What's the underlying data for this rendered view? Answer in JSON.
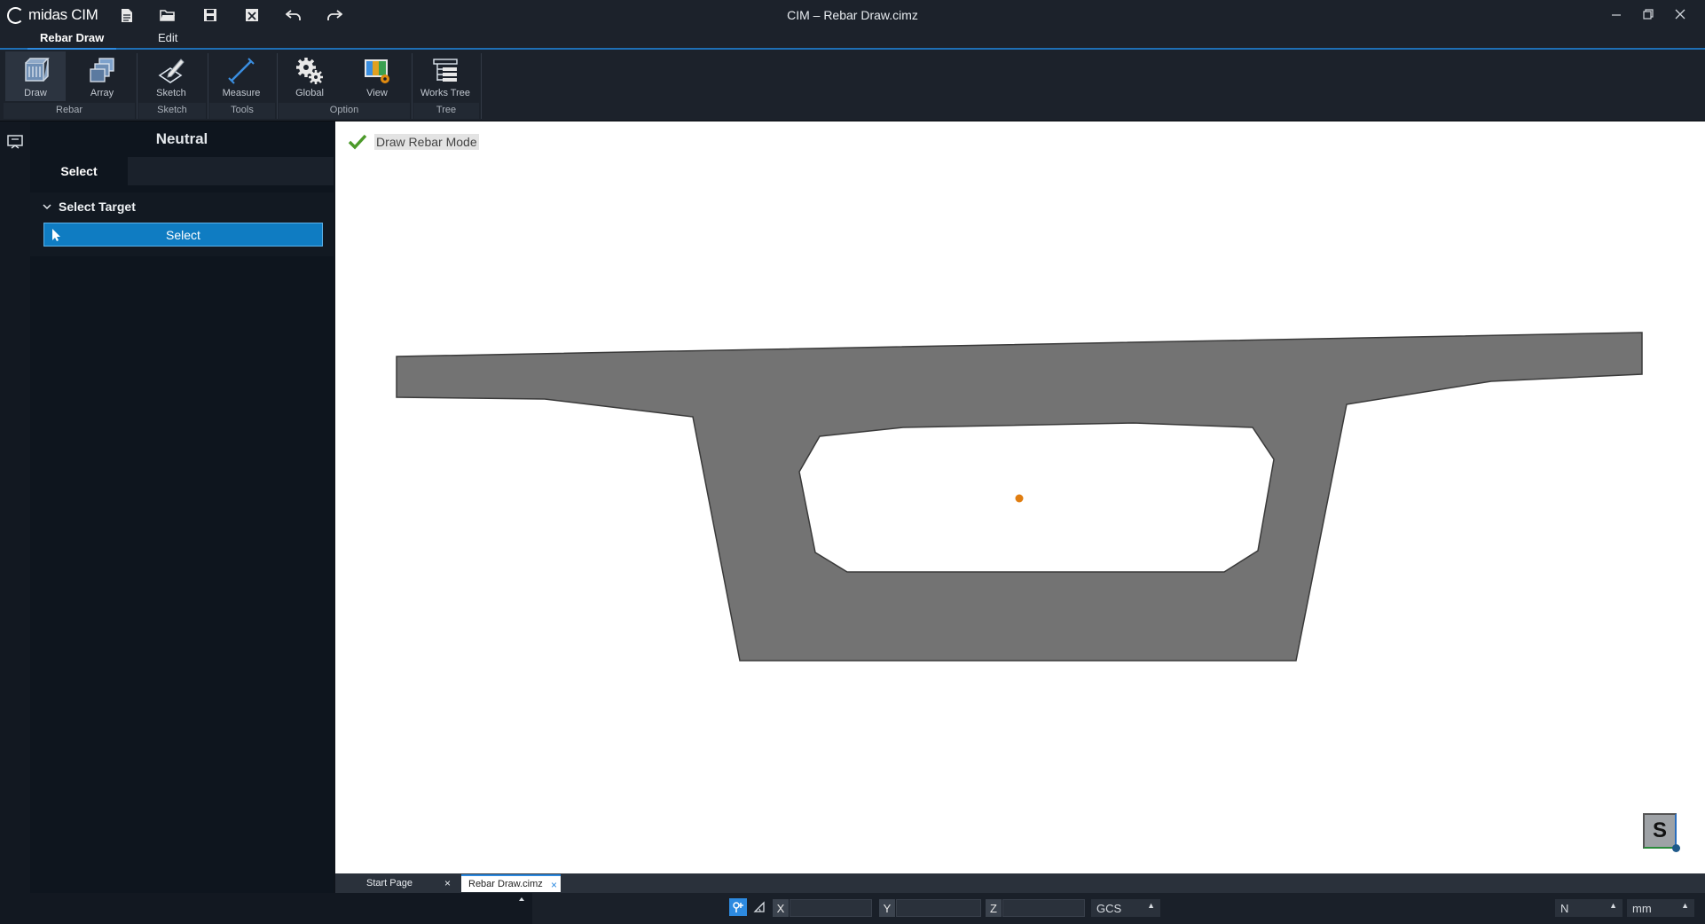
{
  "app": {
    "name": "midas CIM",
    "window_title": "CIM – Rebar Draw.cimz"
  },
  "quick_access": [
    {
      "name": "new-file-icon"
    },
    {
      "name": "open-folder-icon"
    },
    {
      "name": "save-icon"
    },
    {
      "name": "close-file-icon"
    },
    {
      "name": "undo-icon"
    },
    {
      "name": "redo-icon"
    }
  ],
  "menu": {
    "tabs": [
      "Rebar Draw",
      "Edit"
    ],
    "active": "Rebar Draw"
  },
  "ribbon": {
    "buttons": {
      "draw": "Draw",
      "array": "Array",
      "sketch": "Sketch",
      "measure": "Measure",
      "global": "Global",
      "view": "View",
      "works_tree": "Works Tree"
    },
    "groups": {
      "rebar": "Rebar",
      "sketch": "Sketch",
      "tools": "Tools",
      "option": "Option",
      "tree": "Tree"
    }
  },
  "panel": {
    "title": "Neutral",
    "tabs": [
      "Select"
    ],
    "section_title": "Select Target",
    "select_button": "Select"
  },
  "viewport": {
    "mode_label": "Draw Rebar Mode",
    "navcube_label": "S",
    "colors": {
      "section_fill": "#737373",
      "section_stroke": "#3a3a3a",
      "origin_point": "#e07d10"
    }
  },
  "doc_tabs": [
    {
      "label": "Start Page",
      "active": false
    },
    {
      "label": "Rebar Draw.cimz",
      "active": true
    }
  ],
  "statusbar": {
    "x_label": "X",
    "y_label": "Y",
    "z_label": "Z",
    "x_value": "",
    "y_value": "",
    "z_value": "",
    "coord_system": "GCS",
    "force_unit": "N",
    "length_unit": "mm"
  }
}
